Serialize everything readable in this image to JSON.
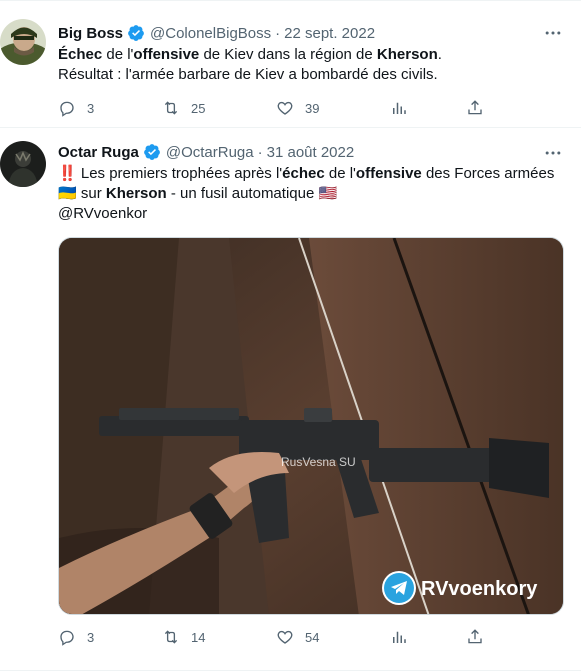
{
  "tweets": [
    {
      "name": "Big Boss",
      "handle": "@ColonelBigBoss",
      "separator": "·",
      "date": "22 sept. 2022",
      "line1": [
        {
          "t": "Échec",
          "b": true
        },
        {
          "t": " de l'",
          "b": false
        },
        {
          "t": "offensive",
          "b": true
        },
        {
          "t": " de Kiev dans la région de ",
          "b": false
        },
        {
          "t": "Kherson",
          "b": true
        },
        {
          "t": ".",
          "b": false
        }
      ],
      "line2": "Résultat : l'armée barbare de Kiev a bombardé des civils.",
      "replies": "3",
      "retweets": "25",
      "likes": "39"
    },
    {
      "name": "Octar Ruga",
      "handle": "@OctarRuga",
      "separator": "·",
      "date": "31 août 2022",
      "line1_prefix": "‼️",
      "line1": [
        {
          "t": " Les premiers trophées après l'",
          "b": false
        },
        {
          "t": "échec",
          "b": true
        },
        {
          "t": " de l'",
          "b": false
        },
        {
          "t": "offensive",
          "b": true
        },
        {
          "t": " des Forces armées",
          "b": false
        }
      ],
      "line2": [
        {
          "t": "🇺🇦",
          "b": false
        },
        {
          "t": " sur ",
          "b": false
        },
        {
          "t": "Kherson",
          "b": true
        },
        {
          "t": " - un fusil automatique ",
          "b": false
        },
        {
          "t": "🇺🇸",
          "b": false
        }
      ],
      "line3": "@RVvoenkor",
      "media_watermark": "RusVesna SU",
      "media_channel": "RVvoenkory",
      "replies": "3",
      "retweets": "14",
      "likes": "54"
    }
  ],
  "colors": {
    "verified": "#1d9bf0",
    "secondary_text": "#536471",
    "border": "#eff3f4"
  },
  "icons": [
    "verified-badge-icon",
    "more-icon",
    "reply-icon",
    "retweet-icon",
    "like-icon",
    "views-icon",
    "share-icon",
    "telegram-icon"
  ]
}
